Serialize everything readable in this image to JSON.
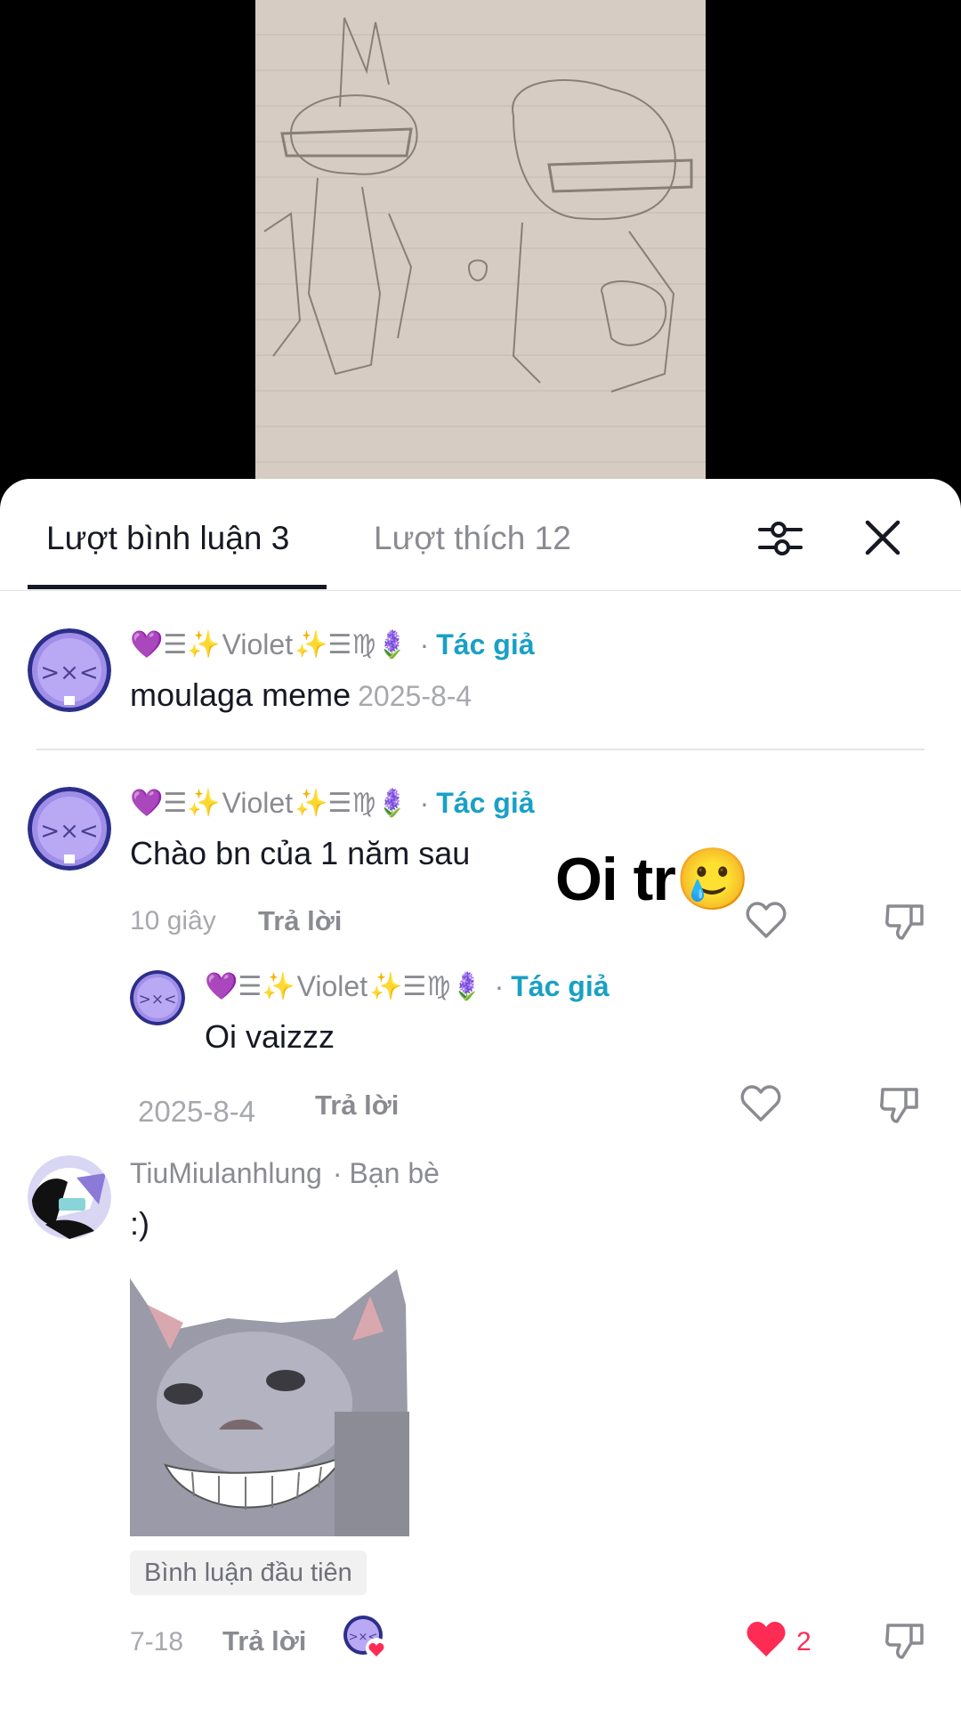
{
  "colors": {
    "accent_author": "#1aa0c6",
    "like_red": "#fe2c55",
    "text_primary": "#161823",
    "text_secondary": "#8a8b91"
  },
  "tabs": {
    "comments_label": "Lượt bình luận 3",
    "likes_label": "Lượt thích 12"
  },
  "icons": {
    "filter": "sliders-icon",
    "close": "close-icon",
    "like": "heart-outline-icon",
    "dislike": "thumbs-down-icon",
    "liked": "heart-filled-icon"
  },
  "comments": [
    {
      "user_prefix": "💜☰✨",
      "user_name": "Violet",
      "user_suffix": "✨☰♍🪻",
      "author_tag": "Tác giả",
      "text": "moulaga meme",
      "date": "2025-8-4"
    },
    {
      "user_prefix": "💜☰✨",
      "user_name": "Violet",
      "user_suffix": "✨☰♍🪻",
      "author_tag": "Tác giả",
      "text": "Chào bn của 1 năm sau",
      "time": "10 giây",
      "reply_label": "Trả lời",
      "reply": {
        "user_prefix": "💜☰✨",
        "user_name": "Violet",
        "user_suffix": "✨☰♍🪻",
        "author_tag": "Tác giả",
        "text": "Oi vaizzz",
        "date": "2025-8-4",
        "reply_label": "Trả lời"
      }
    },
    {
      "user_name": "TiuMiulanhlung",
      "friend_tag": "Bạn bè",
      "text": ":)",
      "badge": "Bình luận đầu tiên",
      "date": "7-18",
      "reply_label": "Trả lời",
      "like_count": "2"
    }
  ],
  "overlay_text": "Oi tr🥲"
}
